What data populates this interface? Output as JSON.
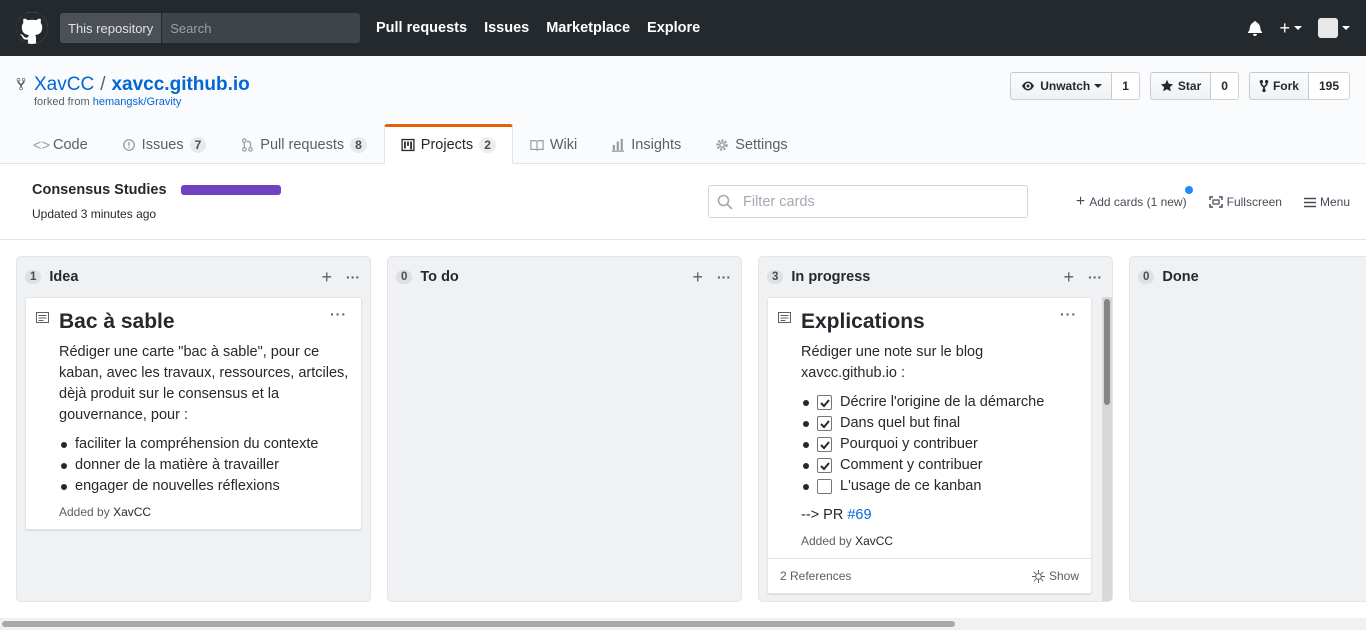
{
  "header": {
    "scope_label": "This repository",
    "search_placeholder": "Search",
    "nav": [
      "Pull requests",
      "Issues",
      "Marketplace",
      "Explore"
    ]
  },
  "repo": {
    "owner": "XavCC",
    "name": "xavcc.github.io",
    "forked_prefix": "forked from",
    "forked_source": "hemangsk/Gravity",
    "watch_label": "Unwatch",
    "watch_count": "1",
    "star_label": "Star",
    "star_count": "0",
    "fork_label": "Fork",
    "fork_count": "195"
  },
  "tabs": [
    {
      "label": "Code",
      "count": null
    },
    {
      "label": "Issues",
      "count": "7"
    },
    {
      "label": "Pull requests",
      "count": "8"
    },
    {
      "label": "Projects",
      "count": "2"
    },
    {
      "label": "Wiki",
      "count": null
    },
    {
      "label": "Insights",
      "count": null
    },
    {
      "label": "Settings",
      "count": null
    }
  ],
  "project": {
    "title": "Consensus Studies",
    "progress": 1.0,
    "progress_color": "#6f42c1",
    "updated": "Updated 3 minutes ago",
    "filter_placeholder": "Filter cards",
    "add_cards": "Add cards (1 new)",
    "fullscreen": "Fullscreen",
    "menu": "Menu"
  },
  "columns": [
    {
      "name": "Idea",
      "count": "1",
      "card": {
        "title": "Bac à sable",
        "body": "Rédiger une carte \"bac à sable\", pour ce kaban, avec les travaux, ressources, artciles, dèjà produit sur le consensus et la gouvernance, pour :",
        "bullets": [
          "faciliter la compréhension du contexte",
          "donner de la matière à travailler",
          "engager de nouvelles réflexions"
        ],
        "added_prefix": "Added by",
        "added_by": "XavCC"
      }
    },
    {
      "name": "To do",
      "count": "0"
    },
    {
      "name": "In progress",
      "count": "3",
      "card": {
        "title": "Explications",
        "body": "Rédiger une note sur le blog xavcc.github.io :",
        "tasks": [
          {
            "label": "Décrire l'origine de la démarche",
            "checked": true
          },
          {
            "label": "Dans quel but final",
            "checked": true
          },
          {
            "label": "Pourquoi y contribuer",
            "checked": true
          },
          {
            "label": "Comment y contribuer",
            "checked": true
          },
          {
            "label": "L'usage de ce kanban",
            "checked": false
          }
        ],
        "pr_text": "--> PR",
        "pr_link": "#69",
        "added_prefix": "Added by",
        "added_by": "XavCC",
        "references": "2 References",
        "show": "Show"
      }
    },
    {
      "name": "Done",
      "count": "0"
    }
  ]
}
